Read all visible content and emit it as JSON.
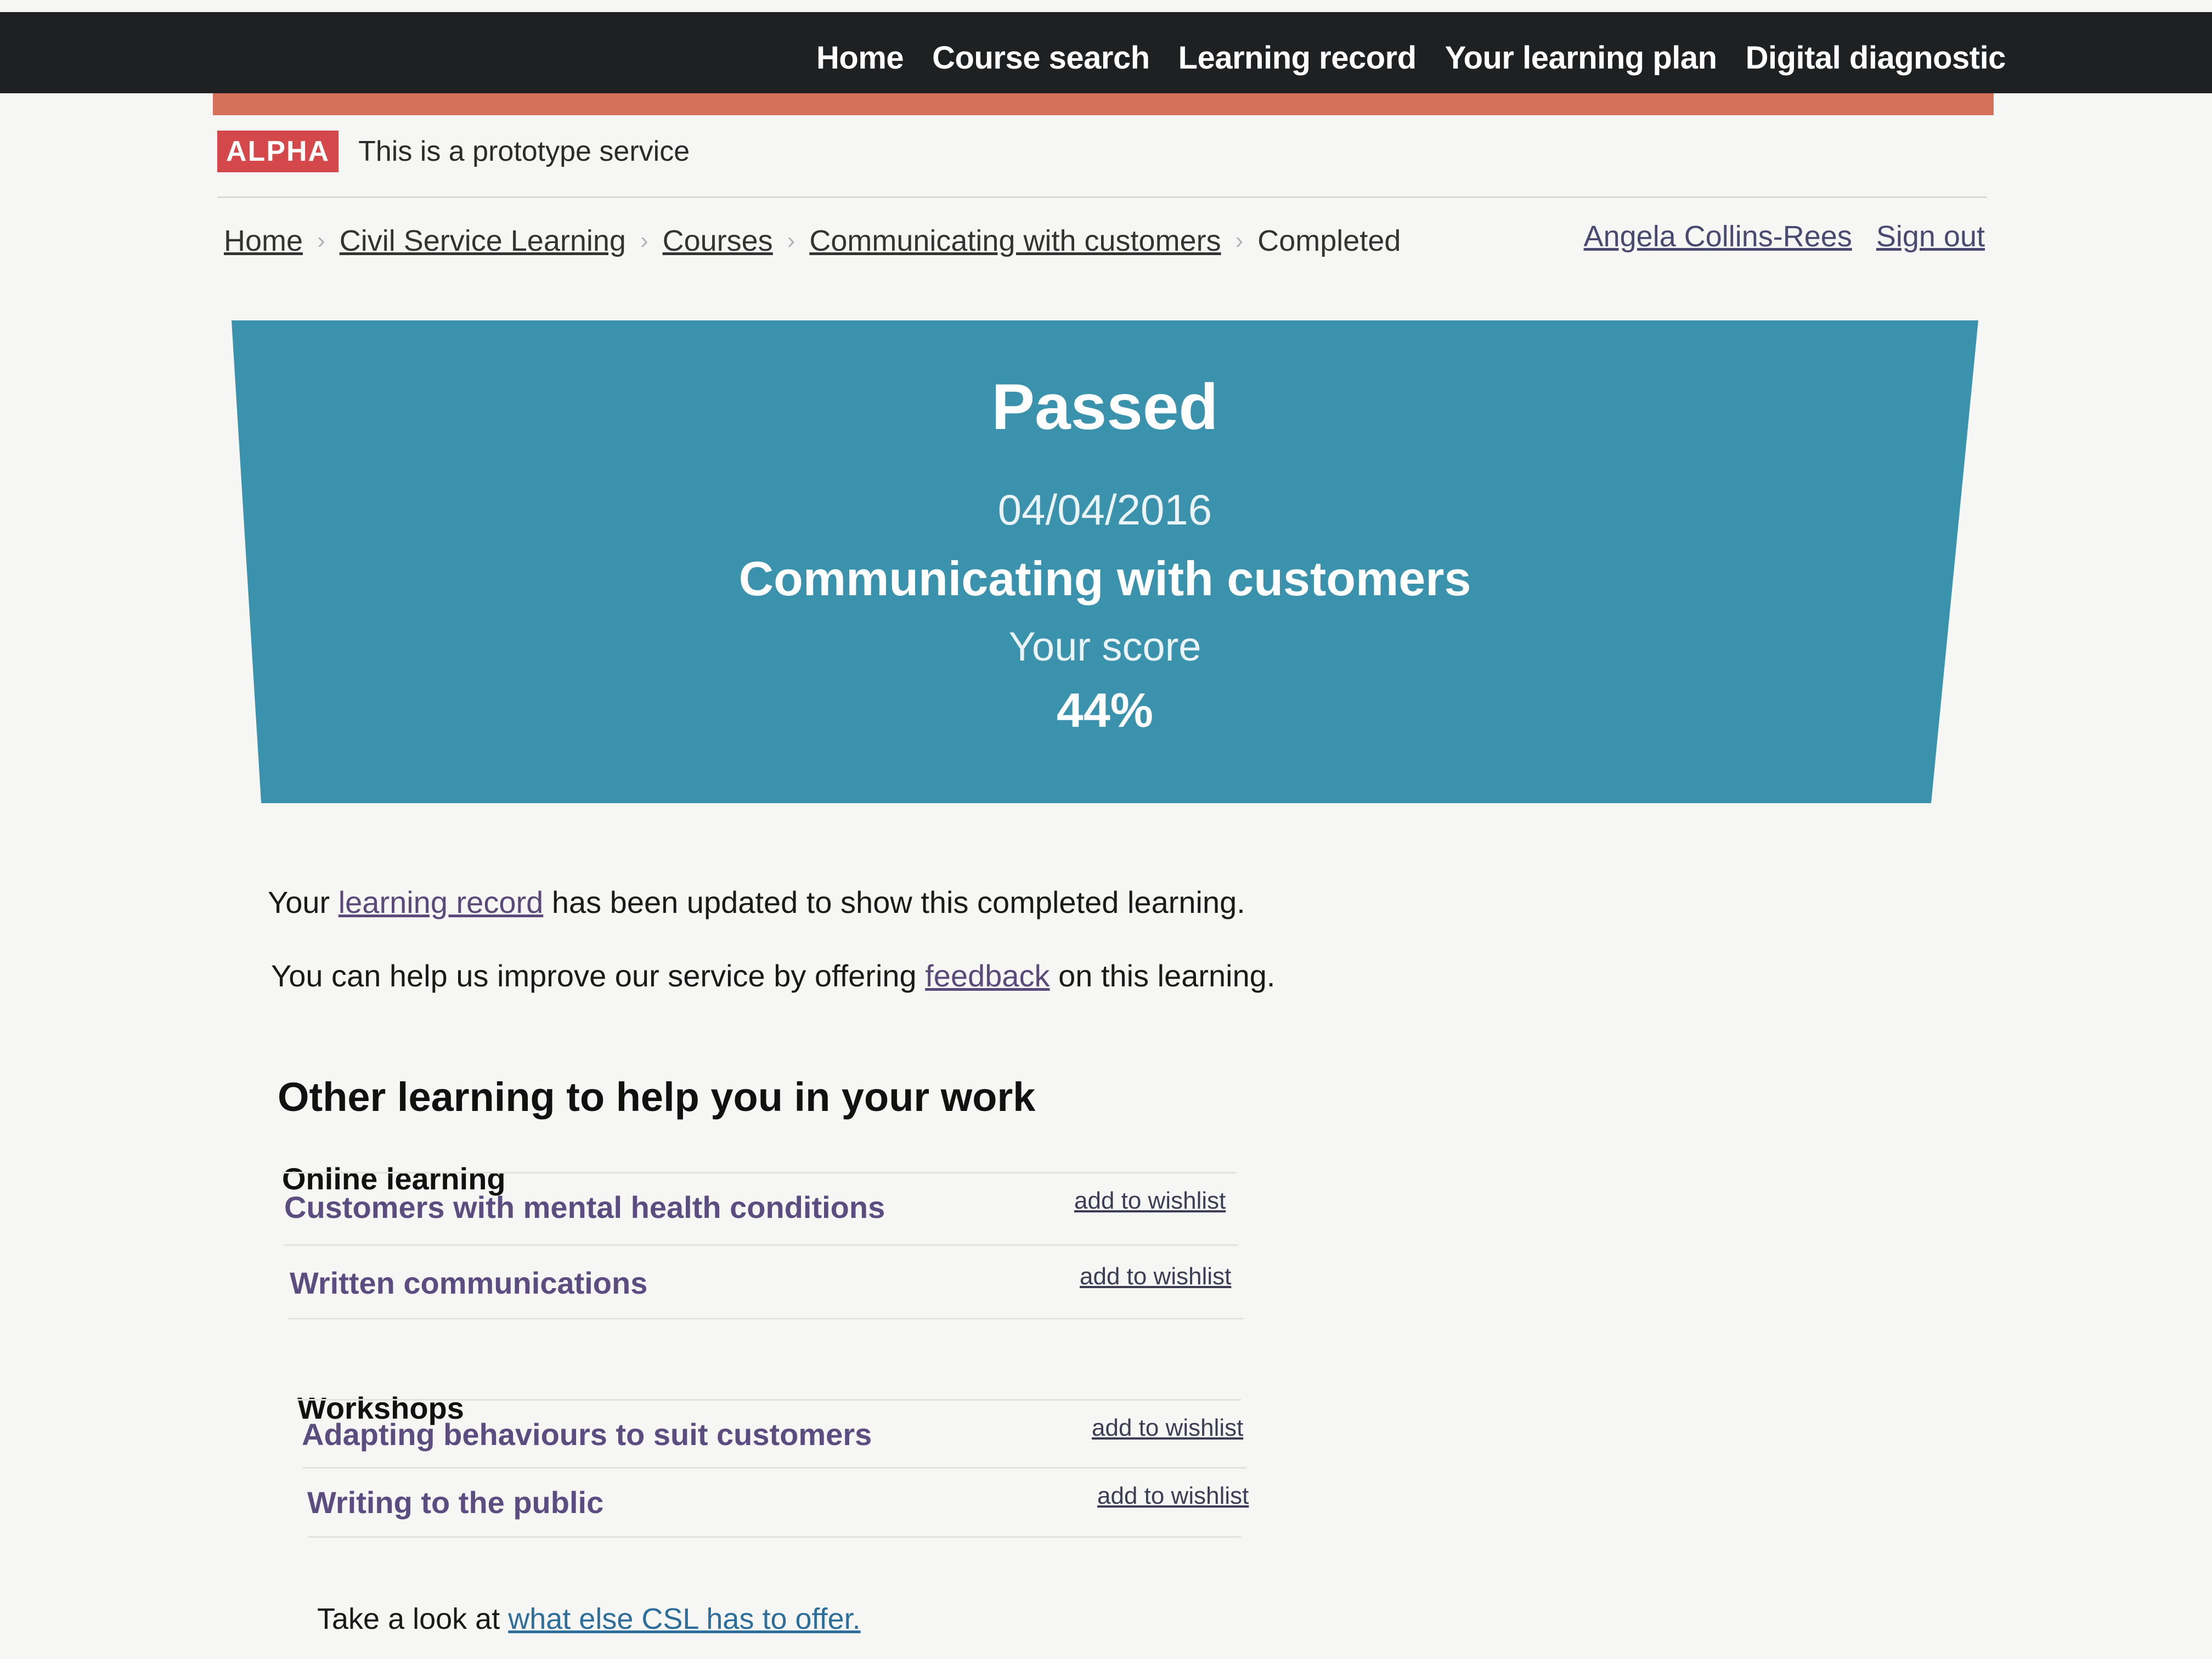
{
  "nav": {
    "items": [
      {
        "label": "Home"
      },
      {
        "label": "Course search"
      },
      {
        "label": "Learning record"
      },
      {
        "label": "Your learning plan"
      },
      {
        "label": "Digital diagnostic"
      }
    ]
  },
  "phase_banner": {
    "tag": "ALPHA",
    "text": "This is a prototype service"
  },
  "breadcrumb": {
    "items": [
      {
        "label": "Home"
      },
      {
        "label": "Civil Service Learning"
      },
      {
        "label": "Courses"
      },
      {
        "label": "Communicating with customers"
      }
    ],
    "current": "Completed"
  },
  "user": {
    "name": "Angela Collins-Rees",
    "sign_out": "Sign out"
  },
  "result": {
    "status": "Passed",
    "date": "04/04/2016",
    "course": "Communicating with customers",
    "score_label": "Your score",
    "score": "44%"
  },
  "messages": {
    "record_prefix": "Your ",
    "record_link": "learning record",
    "record_suffix": " has been updated to show this completed learning.",
    "feedback_prefix": "You can help us improve our service by offering ",
    "feedback_link": "feedback",
    "feedback_suffix": " on this learning."
  },
  "other_learning": {
    "heading": "Other learning to help you in your work",
    "online": {
      "heading": "Online learning",
      "items": [
        {
          "title": "Customers with mental health conditions",
          "action": "add to wishlist"
        },
        {
          "title": "Written communications",
          "action": "add to wishlist"
        }
      ]
    },
    "workshops": {
      "heading": "Workshops",
      "items": [
        {
          "title": "Adapting behaviours to suit customers",
          "action": "add to wishlist"
        },
        {
          "title": "Writing to the public",
          "action": "add to wishlist"
        }
      ]
    },
    "footer_prefix": "Take a look at ",
    "footer_link": "what else CSL has to offer."
  },
  "colors": {
    "header_bg": "#1f2021",
    "accent_bar": "#d5705a",
    "phase_tag": "#d4484b",
    "panel_bg": "#3a92ad",
    "link": "#5b4d80"
  }
}
